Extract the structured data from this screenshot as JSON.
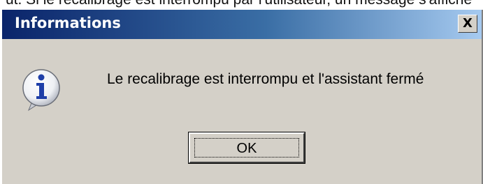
{
  "background_text": "ut. Si le recalibrage est interrompu par l'utilisateur, un message s'affiche",
  "dialog": {
    "title": "Informations",
    "close_label": "X",
    "message": "Le recalibrage est interrompu et l'assistant fermé",
    "ok_label": "OK",
    "icon": "info-icon"
  },
  "colors": {
    "titlebar_start": "#0a246a",
    "titlebar_end": "#a6caf0",
    "dialog_face": "#d4d0c8",
    "icon_blue": "#1f3fa8"
  }
}
